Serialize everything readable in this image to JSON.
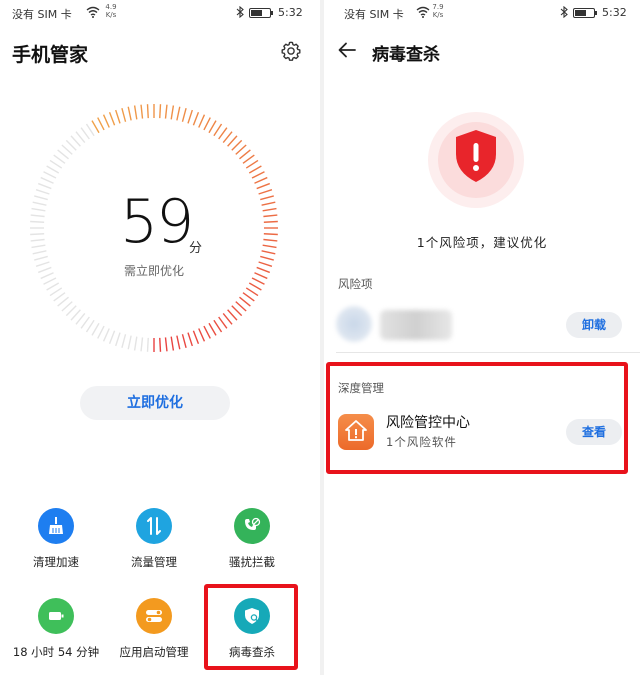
{
  "left": {
    "status": {
      "carrier": "没有 SIM 卡",
      "speed_value": "4.9",
      "speed_unit": "K/s",
      "time": "5:32"
    },
    "title": "手机管家",
    "score": {
      "value": "59",
      "unit": "分",
      "caption": "需立即优化",
      "fraction": 0.59
    },
    "optimize_button": "立即优化",
    "tools": [
      {
        "label": "清理加速",
        "icon": "broom-icon",
        "color": "#1e7ef0"
      },
      {
        "label": "流量管理",
        "icon": "data-arrows-icon",
        "color": "#1fa4e0"
      },
      {
        "label": "骚扰拦截",
        "icon": "phone-block-icon",
        "color": "#34b35a"
      },
      {
        "label": "18 小时 54 分钟",
        "icon": "battery-icon",
        "color": "#3fbf5a"
      },
      {
        "label": "应用启动管理",
        "icon": "toggle-icon",
        "color": "#f39a1f"
      },
      {
        "label": "病毒查杀",
        "icon": "shield-search-icon",
        "color": "#16a9b8"
      }
    ]
  },
  "right": {
    "status": {
      "carrier": "没有 SIM 卡",
      "speed_value": "7.9",
      "speed_unit": "K/s",
      "time": "5:32"
    },
    "title": "病毒查杀",
    "risk_summary": "1个风险项，建议优化",
    "risk_section_label": "风险项",
    "uninstall_button": "卸载",
    "deep_section_label": "深度管理",
    "center": {
      "name": "风险管控中心",
      "sub": "1个风险软件",
      "view_button": "查看"
    }
  },
  "colors": {
    "accent": "#1f6fe0",
    "danger": "#e8121b",
    "ring_low": "#e94040",
    "ring_high": "#f0a34a"
  }
}
